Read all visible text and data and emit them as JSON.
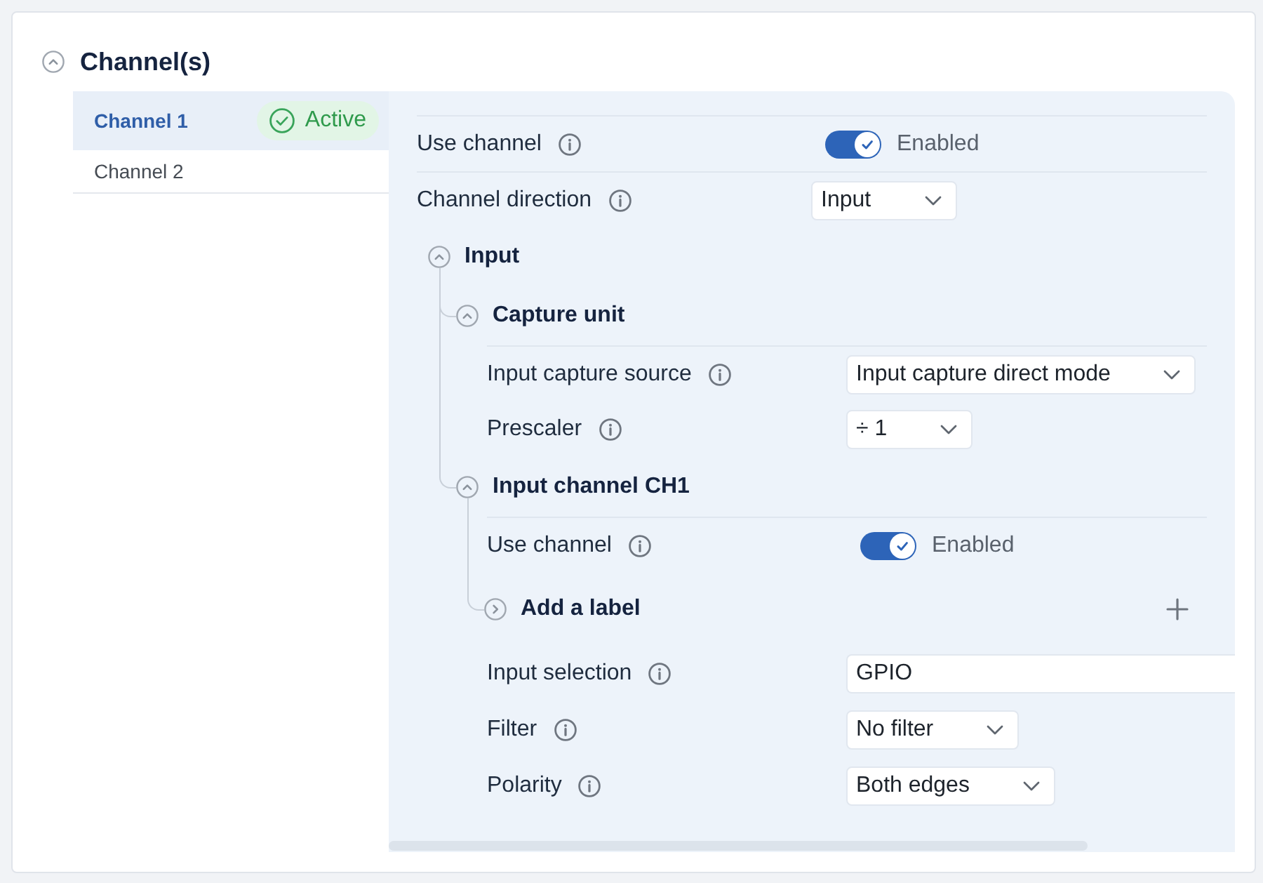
{
  "section": {
    "title": "Channel(s)",
    "expanded": true
  },
  "channels": [
    {
      "label": "Channel 1",
      "selected": true,
      "badge": "Active"
    },
    {
      "label": "Channel 2",
      "selected": false
    }
  ],
  "settings": [
    {
      "kind": "toggle",
      "label": "Use channel",
      "on": true,
      "value": "Enabled"
    },
    {
      "kind": "select",
      "label": "Channel direction",
      "value": "Input"
    },
    {
      "kind": "group",
      "title": "Input",
      "expanded": true,
      "children": [
        {
          "kind": "group",
          "title": "Capture unit",
          "expanded": true,
          "children": [
            {
              "kind": "select",
              "label": "Input capture source",
              "value": "Input capture direct mode"
            },
            {
              "kind": "select",
              "label": "Prescaler",
              "value": "÷ 1"
            }
          ]
        },
        {
          "kind": "group",
          "title": "Input channel CH1",
          "expanded": true,
          "children": [
            {
              "kind": "toggle",
              "label": "Use channel",
              "on": true,
              "value": "Enabled"
            },
            {
              "kind": "group",
              "title": "Add a label",
              "expanded": false,
              "addable": true
            },
            {
              "kind": "text",
              "label": "Input selection",
              "value": "GPIO"
            },
            {
              "kind": "select",
              "label": "Filter",
              "value": "No filter"
            },
            {
              "kind": "select",
              "label": "Polarity",
              "value": "Both edges"
            }
          ]
        }
      ]
    }
  ]
}
